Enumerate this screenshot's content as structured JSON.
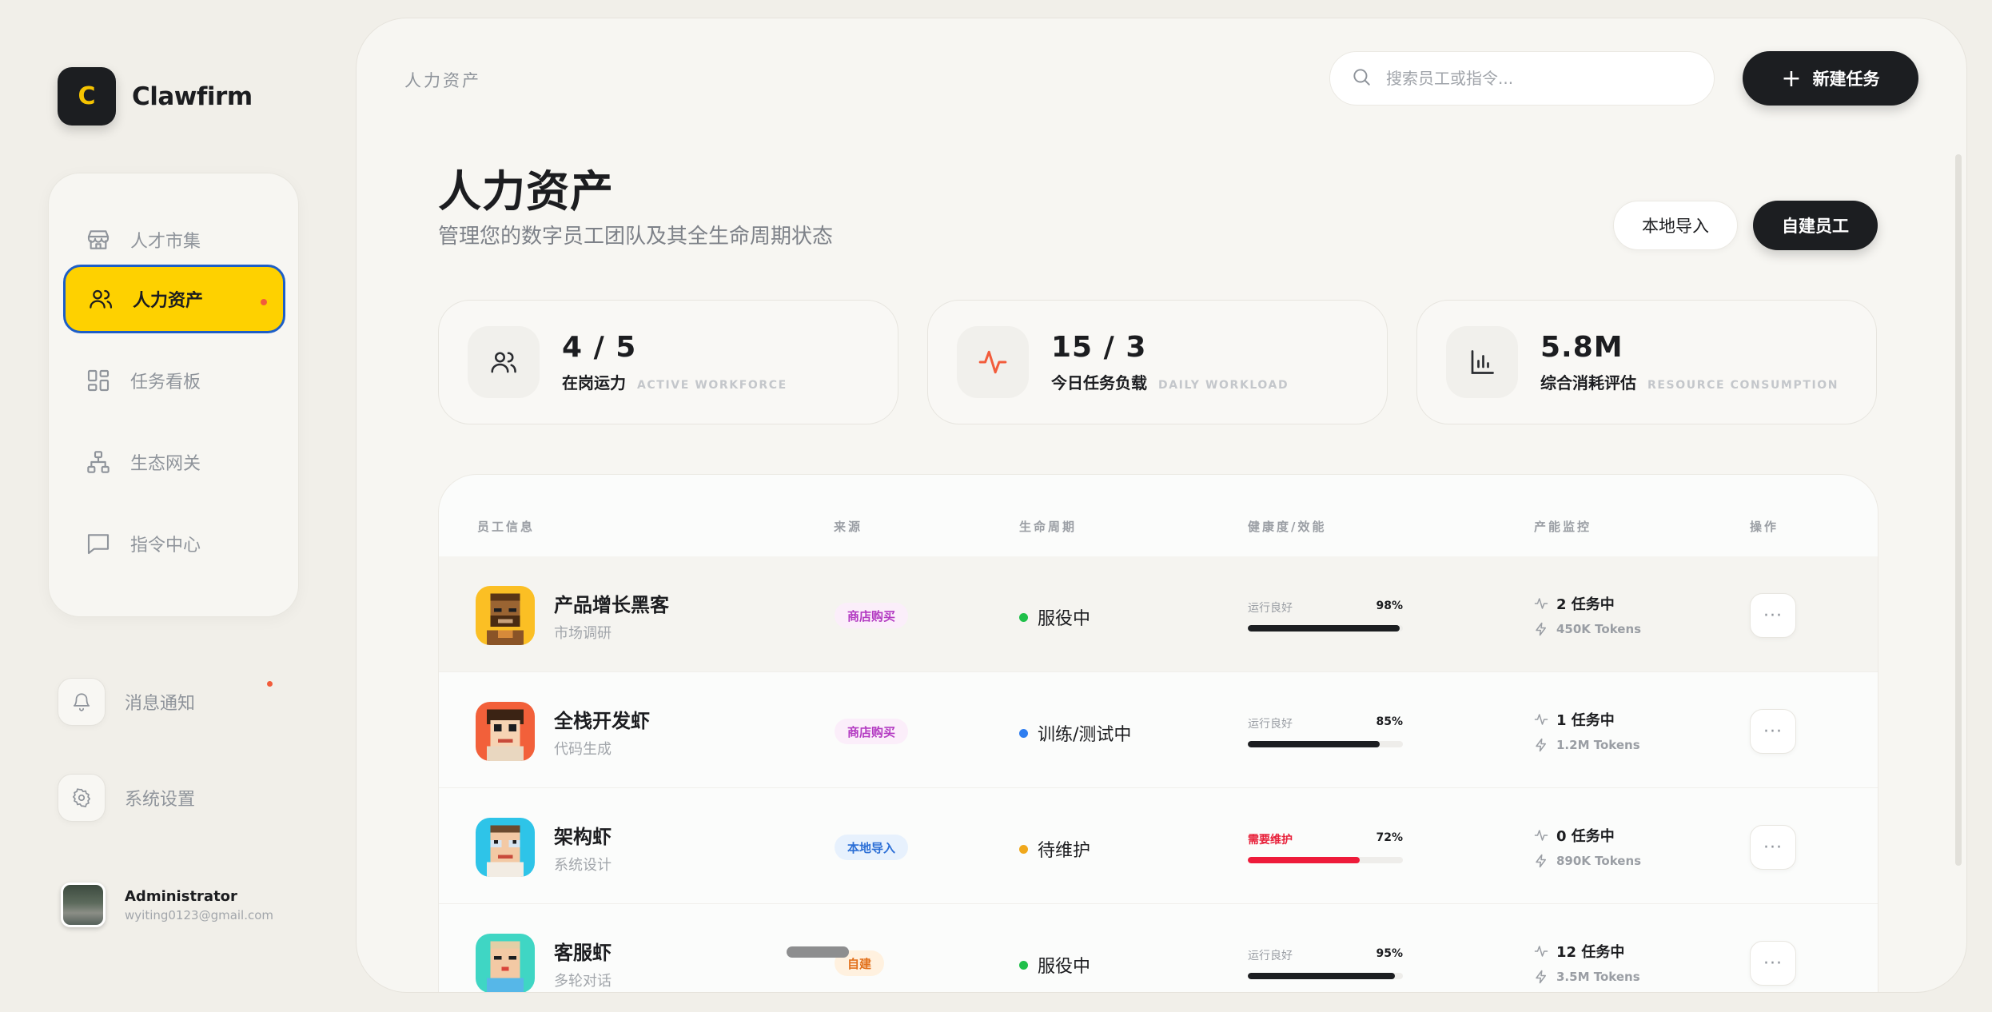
{
  "brand": {
    "logo_letter": "C",
    "name": "Clawfirm"
  },
  "nav": {
    "items": [
      {
        "label": "人才市集",
        "icon": "store-icon",
        "active": false
      },
      {
        "label": "人力资产",
        "icon": "users-icon",
        "active": true
      },
      {
        "label": "任务看板",
        "icon": "grid-icon",
        "active": false
      },
      {
        "label": "生态网关",
        "icon": "network-icon",
        "active": false
      },
      {
        "label": "指令中心",
        "icon": "message-icon",
        "active": false
      }
    ]
  },
  "utility": {
    "notifications_label": "消息通知",
    "settings_label": "系统设置"
  },
  "user": {
    "name": "Administrator",
    "email": "wyiting0123@gmail.com"
  },
  "header": {
    "breadcrumb": "人力资产",
    "search_placeholder": "搜索员工或指令...",
    "new_task_label": "新建任务"
  },
  "page": {
    "title": "人力资产",
    "subtitle": "管理您的数字员工团队及其全生命周期状态",
    "import_label": "本地导入",
    "create_label": "自建员工"
  },
  "stats": [
    {
      "value": "4 / 5",
      "label": "在岗运力",
      "label_en": "ACTIVE WORKFORCE",
      "icon": "users-icon"
    },
    {
      "value": "15 / 3",
      "label": "今日任务负载",
      "label_en": "DAILY WORKLOAD",
      "icon": "activity-icon"
    },
    {
      "value": "5.8M",
      "label": "综合消耗评估",
      "label_en": "RESOURCE CONSUMPTION",
      "icon": "bar-chart-icon"
    }
  ],
  "table": {
    "headers": [
      "员工信息",
      "来源",
      "生命周期",
      "健康度/效能",
      "产能监控",
      "操作"
    ],
    "rows": [
      {
        "name": "产品增长黑客",
        "role": "市场调研",
        "source": "商店购买",
        "source_kind": "shop",
        "lifecycle": "服役中",
        "lifecycle_color": "#1fc04a",
        "health_label": "运行良好",
        "health_warn": false,
        "health_pct": "98%",
        "health_value": 0.98,
        "tasks": "2 任务中",
        "tokens": "450K Tokens",
        "avatar": "hacker"
      },
      {
        "name": "全栈开发虾",
        "role": "代码生成",
        "source": "商店购买",
        "source_kind": "shop",
        "lifecycle": "训练/测试中",
        "lifecycle_color": "#2f7ef0",
        "health_label": "运行良好",
        "health_warn": false,
        "health_pct": "85%",
        "health_value": 0.85,
        "tasks": "1 任务中",
        "tokens": "1.2M Tokens",
        "avatar": "dev"
      },
      {
        "name": "架构虾",
        "role": "系统设计",
        "source": "本地导入",
        "source_kind": "local",
        "lifecycle": "待维护",
        "lifecycle_color": "#f0a81c",
        "health_label": "需要维护",
        "health_warn": true,
        "health_pct": "72%",
        "health_value": 0.72,
        "tasks": "0 任务中",
        "tokens": "890K Tokens",
        "avatar": "architect"
      },
      {
        "name": "客服虾",
        "role": "多轮对话",
        "source": "自建",
        "source_kind": "self",
        "lifecycle": "服役中",
        "lifecycle_color": "#1fc04a",
        "health_label": "运行良好",
        "health_warn": false,
        "health_pct": "95%",
        "health_value": 0.95,
        "tasks": "12 任务中",
        "tokens": "3.5M Tokens",
        "avatar": "support"
      }
    ],
    "more_label": "···"
  },
  "colors": {
    "accent": "#fed100",
    "dark": "#1c1e21",
    "warn": "#ee1b3a"
  }
}
